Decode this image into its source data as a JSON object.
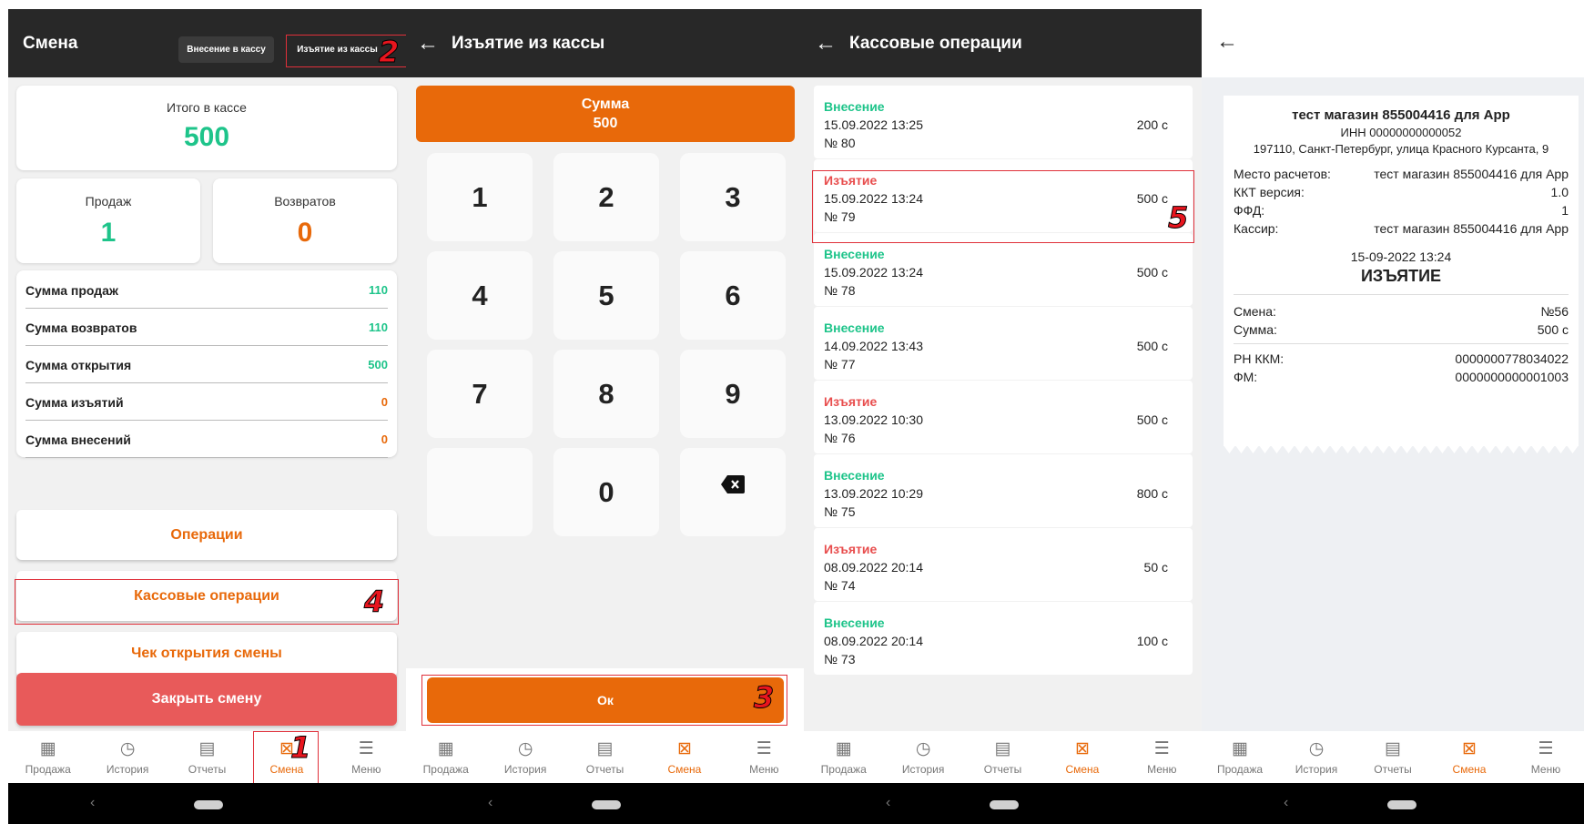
{
  "colors": {
    "accent": "#e8690a",
    "green": "#1ec48a",
    "red": "#e84d4d",
    "header": "#282828",
    "close_button": "#e85a5a"
  },
  "annotations": [
    "1",
    "2",
    "3",
    "4",
    "5"
  ],
  "tabs": [
    {
      "label": "Продажа",
      "icon": "sale-icon"
    },
    {
      "label": "История",
      "icon": "history-icon"
    },
    {
      "label": "Отчеты",
      "icon": "reports-icon"
    },
    {
      "label": "Смена",
      "icon": "shift-icon"
    },
    {
      "label": "Меню",
      "icon": "menu-icon"
    }
  ],
  "shift": {
    "title": "Смена",
    "deposit_button": "Внесение в кассу",
    "withdraw_button": "Изъятие из кассы",
    "total_label": "Итого в кассе",
    "total_value": "500",
    "sales_label": "Продаж",
    "sales_value": "1",
    "returns_label": "Возвратов",
    "returns_value": "0",
    "summary": [
      {
        "label": "Сумма продаж",
        "value": "110"
      },
      {
        "label": "Сумма возвратов",
        "value": "110"
      },
      {
        "label": "Сумма открытия",
        "value": "500"
      },
      {
        "label": "Сумма изъятий",
        "value": "0"
      },
      {
        "label": "Сумма внесений",
        "value": "0"
      }
    ],
    "operations_button": "Операции",
    "cash_operations_button": "Кассовые операции",
    "open_receipt_button": "Чек открытия смены",
    "close_shift_button": "Закрыть смену"
  },
  "withdraw": {
    "title": "Изъятие из кассы",
    "sum_label": "Сумма",
    "sum_value": "500",
    "keys": [
      "1",
      "2",
      "3",
      "4",
      "5",
      "6",
      "7",
      "8",
      "9",
      "0"
    ],
    "ok_button": "Ок"
  },
  "cash_ops": {
    "title": "Кассовые операции",
    "items": [
      {
        "type": "Внесение",
        "date": "15.09.2022 13:25",
        "number": "№ 80",
        "amount": "200 с",
        "kind": "in"
      },
      {
        "type": "Изъятие",
        "date": "15.09.2022 13:24",
        "number": "№ 79",
        "amount": "500 с",
        "kind": "out"
      },
      {
        "type": "Внесение",
        "date": "15.09.2022 13:24",
        "number": "№ 78",
        "amount": "500 с",
        "kind": "in"
      },
      {
        "type": "Внесение",
        "date": "14.09.2022 13:43",
        "number": "№ 77",
        "amount": "500 с",
        "kind": "in"
      },
      {
        "type": "Изъятие",
        "date": "13.09.2022 10:30",
        "number": "№ 76",
        "amount": "500 с",
        "kind": "out"
      },
      {
        "type": "Внесение",
        "date": "13.09.2022 10:29",
        "number": "№ 75",
        "amount": "800 с",
        "kind": "in"
      },
      {
        "type": "Изъятие",
        "date": "08.09.2022 20:14",
        "number": "№ 74",
        "amount": "50 с",
        "kind": "out"
      },
      {
        "type": "Внесение",
        "date": "08.09.2022 20:14",
        "number": "№ 73",
        "amount": "100 с",
        "kind": "in"
      }
    ]
  },
  "receipt": {
    "store": "тест магазин 855004416 для App",
    "inn": "ИНН 00000000000052",
    "address": "197110, Санкт-Петербург, улица Красного Курсанта, 9",
    "info": [
      {
        "label": "Место расчетов:",
        "value": "тест магазин 855004416 для App"
      },
      {
        "label": "ККТ версия:",
        "value": "1.0"
      },
      {
        "label": "ФФД:",
        "value": "1"
      },
      {
        "label": "Кассир:",
        "value": "тест магазин 855004416 для App"
      }
    ],
    "datetime": "15-09-2022 13:24",
    "doc_type": "ИЗЪЯТИЕ",
    "totals": [
      {
        "label": "Смена:",
        "value": "№56"
      },
      {
        "label": "Сумма:",
        "value": "500 с"
      }
    ],
    "fiscal": [
      {
        "label": "РН ККМ:",
        "value": "0000000778034022"
      },
      {
        "label": "ФМ:",
        "value": "0000000000001003"
      }
    ]
  }
}
